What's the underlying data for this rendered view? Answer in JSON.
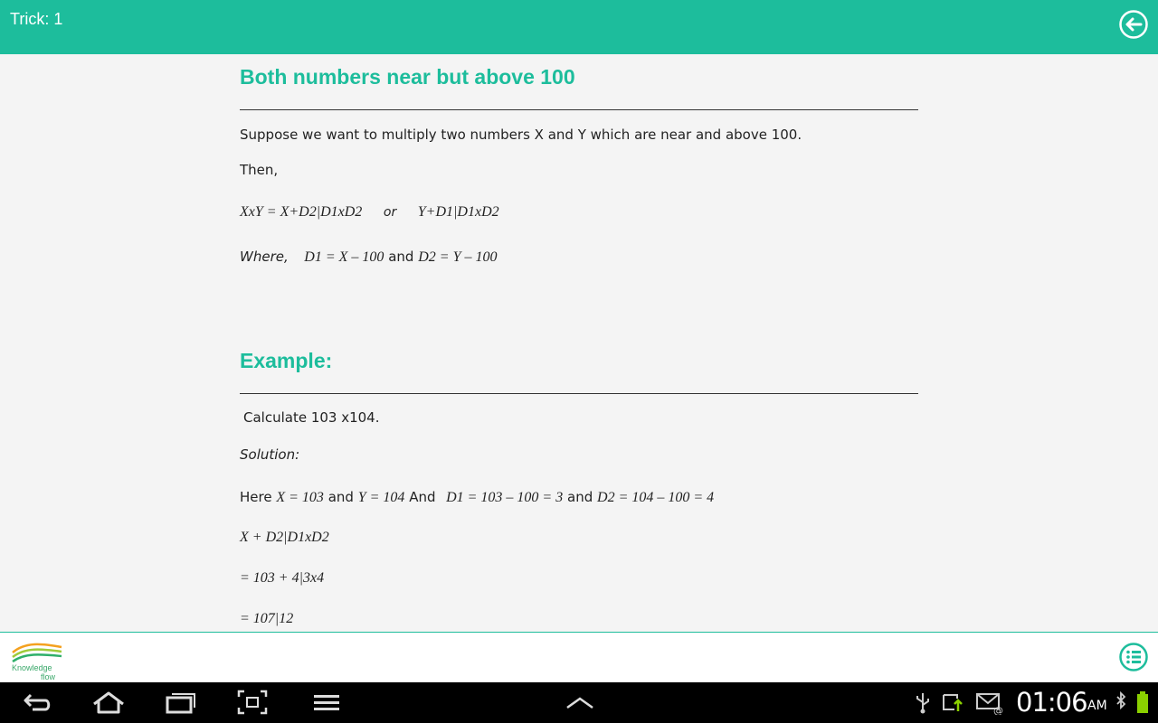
{
  "header": {
    "title": "Trick: 1"
  },
  "section1": {
    "heading": "Both numbers near but above 100",
    "intro": "Suppose we want to multiply two numbers X and Y which are near and above 100.",
    "then": "Then,",
    "formula_a": "XxY  =  X+D2|D1xD2",
    "formula_or": "or",
    "formula_b": "Y+D1|D1xD2",
    "where_label": "Where,",
    "where_d1": "D1 = X – 100",
    "where_and": "and",
    "where_d2": "D2 = Y – 100"
  },
  "section2": {
    "heading": "Example:",
    "calc": "Calculate 103 x104.",
    "solution": "Solution:",
    "here": "Here",
    "here_x": "X = 103",
    "and1": "and",
    "here_y": "Y = 104",
    "and2": "And",
    "here_d1": "D1 = 103 – 100 = 3",
    "and3": "and",
    "here_d2": "D2 = 104 – 100 = 4",
    "step1": "X + D2|D1xD2",
    "step2": "= 103 + 4|3x4",
    "step3": "= 107|12"
  },
  "footer": {
    "logo_line1": "Knowledge",
    "logo_line2": "flow"
  },
  "system_bar": {
    "time": "01:06",
    "ampm": "AM"
  },
  "colors": {
    "accent": "#1dbd9c",
    "battery": "#8bd000"
  }
}
